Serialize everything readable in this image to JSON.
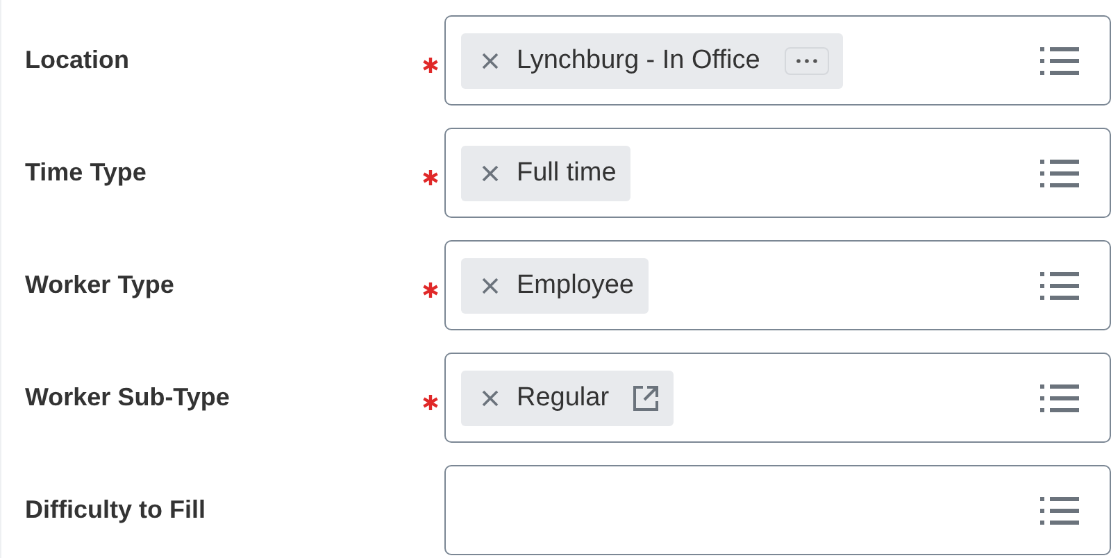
{
  "fields": [
    {
      "label": "Location",
      "required": true,
      "tags": [
        {
          "text": "Lynchburg - In Office",
          "kind": "more"
        }
      ]
    },
    {
      "label": "Time Type",
      "required": true,
      "tags": [
        {
          "text": "Full time",
          "kind": "plain"
        }
      ]
    },
    {
      "label": "Worker Type",
      "required": true,
      "tags": [
        {
          "text": "Employee",
          "kind": "plain"
        }
      ]
    },
    {
      "label": "Worker Sub-Type",
      "required": true,
      "tags": [
        {
          "text": "Regular",
          "kind": "link"
        }
      ]
    },
    {
      "label": "Difficulty to Fill",
      "required": false
    }
  ]
}
